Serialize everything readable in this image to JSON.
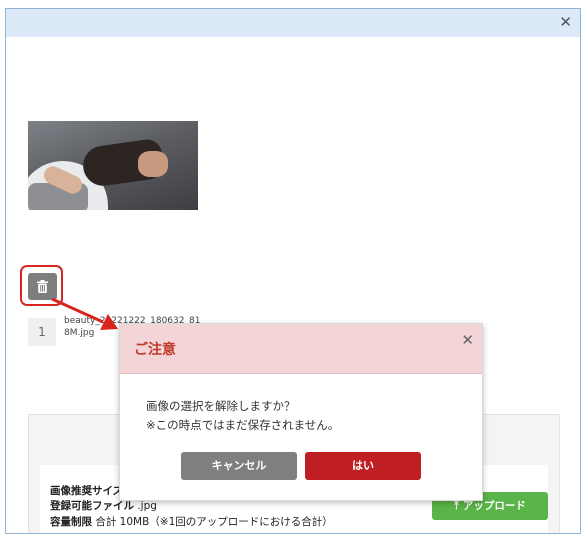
{
  "window": {
    "close_glyph": "✕"
  },
  "file": {
    "index": "1",
    "name": "beauty_20221222_180632_818M.jpg"
  },
  "info": {
    "recommended_size_label": "画像推奨サイズ",
    "allowed_files_label": "登録可能ファイル",
    "allowed_files_value": ".jpg",
    "capacity_label": "容量制限",
    "capacity_value": "合計 10MB（※1回のアップロードにおける合計）",
    "upload_label": "アップロード"
  },
  "modal": {
    "title": "ご注意",
    "close_glyph": "✕",
    "message_line1": "画像の選択を解除しますか？",
    "message_line2": "※この時点ではまだ保存されません。",
    "cancel_label": "キャンセル",
    "yes_label": "はい"
  },
  "colors": {
    "header_blue": "#dce9f8",
    "highlight_red": "#d8251f",
    "modal_header_pink": "#f3d5d7",
    "yes_red": "#bf1f22",
    "cancel_gray": "#7f7f7f",
    "upload_green": "#5bb449"
  }
}
